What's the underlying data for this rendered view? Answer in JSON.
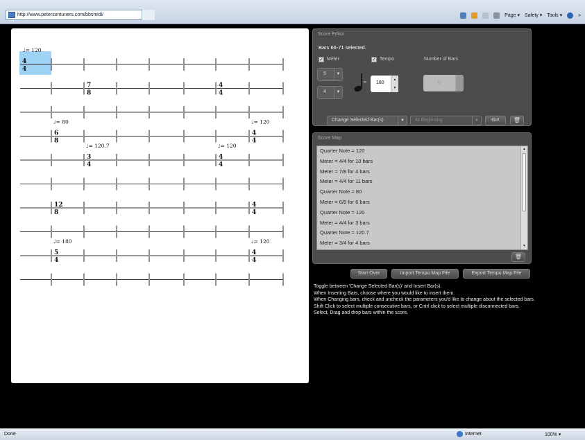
{
  "browser": {
    "url": "http://www.petersontuners.com/bbsmidi/",
    "toolbar": {
      "page": "Page ▾",
      "safety": "Safety ▾",
      "tools": "Tools ▾",
      "more": "»"
    },
    "status": {
      "text": "Done",
      "zone": "Internet",
      "zoom": "100% ▾"
    }
  },
  "score": {
    "rows": [
      {
        "markings": [
          {
            "bar": 0,
            "tempo": "♩= 120",
            "top": "4",
            "bottom": "4"
          }
        ]
      },
      {
        "markings": [
          {
            "bar": 2,
            "top": "7",
            "bottom": "8"
          },
          {
            "bar": 6,
            "top": "4",
            "bottom": "4"
          }
        ]
      },
      {
        "markings": []
      },
      {
        "markings": [
          {
            "bar": 1,
            "tempo": "♩= 80",
            "top": "6",
            "bottom": "8"
          },
          {
            "bar": 7,
            "tempo": "♩= 120",
            "top": "4",
            "bottom": "4"
          }
        ]
      },
      {
        "markings": [
          {
            "bar": 2,
            "tempo": "♩= 120.7",
            "top": "3",
            "bottom": "4"
          },
          {
            "bar": 6,
            "tempo": "♩= 120",
            "top": "4",
            "bottom": "4"
          }
        ]
      },
      {
        "markings": []
      },
      {
        "markings": [
          {
            "bar": 1,
            "top": "12",
            "bottom": "8"
          },
          {
            "bar": 7,
            "top": "4",
            "bottom": "4"
          }
        ]
      },
      {
        "markings": []
      },
      {
        "markings": [
          {
            "bar": 1,
            "tempo": "♩= 180",
            "top": "5",
            "bottom": "4"
          },
          {
            "bar": 7,
            "tempo": "♩= 120",
            "top": "4",
            "bottom": "4"
          }
        ]
      },
      {
        "markings": []
      }
    ],
    "selected_bar": {
      "row": 0,
      "bar": 0
    }
  },
  "editor": {
    "title": "Score Editor",
    "selection_text": "Bars 66-71 selected.",
    "meter_label": "Meter",
    "tempo_label": "Tempo",
    "number_of_bars_label": "Number of Bars",
    "meter_top": "5",
    "meter_bottom": "4",
    "tempo_value": "180",
    "number_of_bars_value": "0",
    "mode_dropdown": "Change Selected Bar(s)",
    "position_dropdown": "At Beginning",
    "go_label": "Go!",
    "meter_checked": true,
    "tempo_checked": true
  },
  "map": {
    "title": "Score Map",
    "items": [
      "Quarter Note = 120",
      "Meter = 4/4 for 10 bars",
      "Meter = 7/8 for 4 bars",
      "Meter = 4/4 for 11 bars",
      "Quarter Note = 80",
      "Meter = 6/8 for 6 bars",
      "Quarter Note = 120",
      "Meter = 4/4 for 3 bars",
      "Quarter Note = 120.7",
      "Meter = 3/4 for 4 bars"
    ]
  },
  "actions": {
    "start_over": "Start Over",
    "import": "Import Tempo Map File",
    "export": "Export Tempo Map File"
  },
  "instructions": [
    "Toggle between 'Change Selected Bar(s)' and Insert Bar(s).",
    "When Inserting Bars, choose where you would like to insert them.",
    "When Changing bars, check and uncheck the parameters you'd like to change about the selected bars.",
    "Shift Click to select multiple consecutive bars, or Cntrl click to select multiple disconnected bars.",
    "Select, Drag and drop bars within the score."
  ],
  "colors": {
    "selection": "#9fd3f5",
    "panel": "#4c4c4c",
    "background": "#000000"
  },
  "icons": {
    "quarter_note": "♩",
    "trash": "trash-icon",
    "checkbox": "✓"
  }
}
